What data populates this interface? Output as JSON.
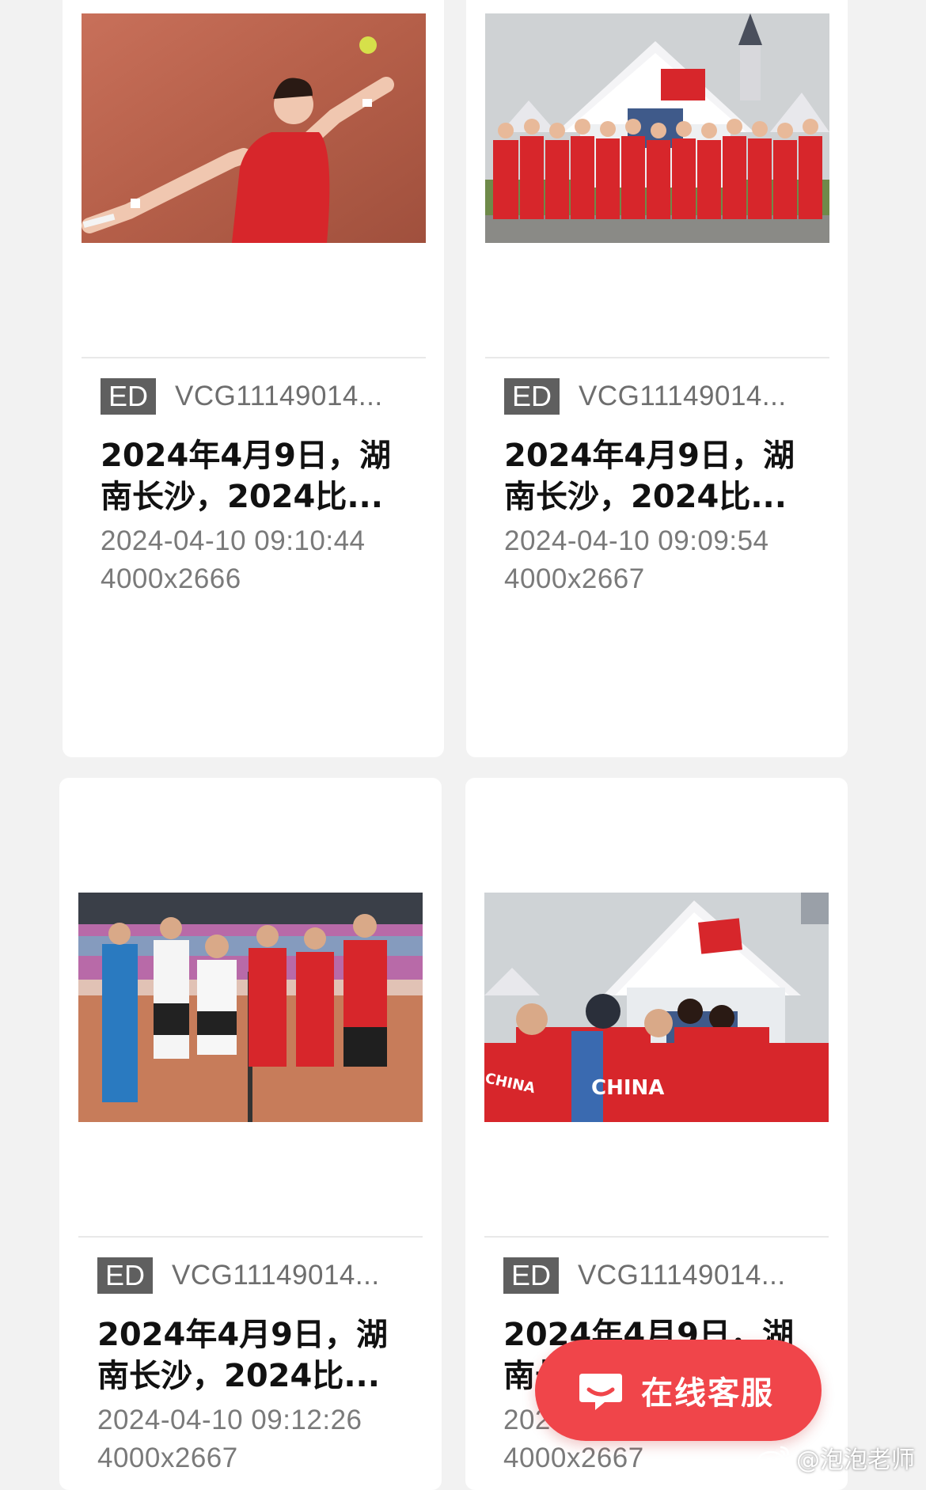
{
  "cards": [
    {
      "badge": "ED",
      "asset_id": "VCG11149014...",
      "title": "2024年4月9日，湖\n南长沙，2024比...",
      "datetime": "2024-04-10 09:10:44",
      "dimensions": "4000x2666",
      "photo_icon": "tennis-serve-photo"
    },
    {
      "badge": "ED",
      "asset_id": "VCG11149014...",
      "title": "2024年4月9日，湖\n南长沙，2024比...",
      "datetime": "2024-04-10 09:09:54",
      "dimensions": "4000x2667",
      "photo_icon": "team-group-photo"
    },
    {
      "badge": "ED",
      "asset_id": "VCG11149014...",
      "title": "2024年4月9日，湖\n南长沙，2024比...",
      "datetime": "2024-04-10 09:12:26",
      "dimensions": "4000x2667",
      "photo_icon": "court-lineup-photo"
    },
    {
      "badge": "ED",
      "asset_id": "VCG11149014...",
      "title": "2024年4月9日，湖\n南长沙，2024比...",
      "datetime": "2024-04-10",
      "dimensions": "4000x2667",
      "photo_icon": "team-huddle-photo"
    }
  ],
  "chat_button": {
    "label": "在线客服",
    "icon": "chat-bubble-icon",
    "color": "#f0454a"
  },
  "watermark": {
    "text": "@泡泡老师",
    "icon": "weibo-icon"
  },
  "colors": {
    "page_bg": "#f2f2f2",
    "badge_bg": "#5f5f5f",
    "accent_red": "#d7262b"
  }
}
